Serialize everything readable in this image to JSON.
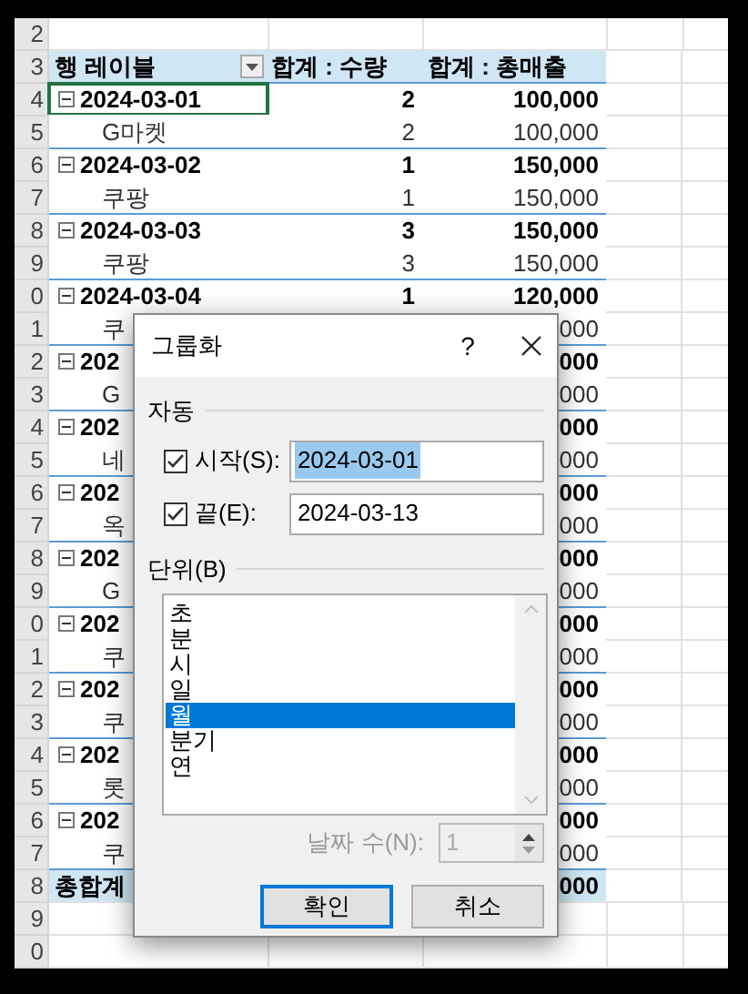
{
  "sheet": {
    "row_numbers": [
      "2",
      "3",
      "4",
      "5",
      "6",
      "7",
      "8",
      "9",
      "0",
      "1",
      "2",
      "3",
      "4",
      "5",
      "6",
      "7",
      "8",
      "9",
      "0",
      "1",
      "2",
      "3",
      "4",
      "5",
      "6",
      "7",
      "8",
      "9",
      "0"
    ],
    "header": {
      "row_label": "행 레이블",
      "sum_qty": "합계 : 수량",
      "sum_sales": "합계 : 총매출"
    },
    "rows": [
      {
        "kind": "date",
        "label": "2024-03-01",
        "qty": "2",
        "sales": "100,000",
        "expanded": true,
        "selected": true
      },
      {
        "kind": "item",
        "label": "G마켓",
        "qty": "2",
        "sales": "100,000",
        "selected": false
      },
      {
        "kind": "date",
        "label": "2024-03-02",
        "qty": "1",
        "sales": "150,000",
        "expanded": true,
        "selected": false
      },
      {
        "kind": "item",
        "label": "쿠팡",
        "qty": "1",
        "sales": "150,000",
        "selected": false
      },
      {
        "kind": "date",
        "label": "2024-03-03",
        "qty": "3",
        "sales": "150,000",
        "expanded": true,
        "selected": false
      },
      {
        "kind": "item",
        "label": "쿠팡",
        "qty": "3",
        "sales": "150,000",
        "selected": false
      },
      {
        "kind": "date",
        "label": "2024-03-04",
        "qty": "1",
        "sales": "120,000",
        "expanded": true,
        "selected": false
      },
      {
        "kind": "item",
        "label": "쿠",
        "sales": "000",
        "selected": false
      },
      {
        "kind": "date",
        "label": "202",
        "sales": "000",
        "expanded": true,
        "selected": false
      },
      {
        "kind": "item",
        "label": "G",
        "sales": "000",
        "selected": false
      },
      {
        "kind": "date",
        "label": "202",
        "sales": "000",
        "expanded": true,
        "selected": false
      },
      {
        "kind": "item",
        "label": "네",
        "sales": "000",
        "selected": false
      },
      {
        "kind": "date",
        "label": "202",
        "sales": "000",
        "expanded": true,
        "selected": false
      },
      {
        "kind": "item",
        "label": "옥",
        "sales": "000",
        "selected": false
      },
      {
        "kind": "date",
        "label": "202",
        "sales": "000",
        "expanded": true,
        "selected": false
      },
      {
        "kind": "item",
        "label": "G",
        "sales": "000",
        "selected": false
      },
      {
        "kind": "date",
        "label": "202",
        "sales": "000",
        "expanded": true,
        "selected": false
      },
      {
        "kind": "item",
        "label": "쿠",
        "sales": "000",
        "selected": false
      },
      {
        "kind": "date",
        "label": "202",
        "sales": "000",
        "expanded": true,
        "selected": false
      },
      {
        "kind": "item",
        "label": "쿠",
        "sales": "000",
        "selected": false
      },
      {
        "kind": "date",
        "label": "202",
        "sales": "000",
        "expanded": true,
        "selected": false
      },
      {
        "kind": "item",
        "label": "롯",
        "sales": "000",
        "selected": false
      },
      {
        "kind": "date",
        "label": "202",
        "sales": "000",
        "expanded": true,
        "selected": false
      },
      {
        "kind": "item",
        "label": "쿠",
        "sales": "000",
        "selected": false
      },
      {
        "kind": "total",
        "label": "총합계",
        "sales": "000",
        "selected": false
      }
    ]
  },
  "dialog": {
    "title": "그룹화",
    "help": "?",
    "auto_section": "자동",
    "start": {
      "label": "시작(S):",
      "checked": true,
      "value": "2024-03-01"
    },
    "end": {
      "label": "끝(E):",
      "checked": true,
      "value": "2024-03-13"
    },
    "unit_section": "단위(B)",
    "units": [
      {
        "label": "초",
        "selected": false
      },
      {
        "label": "분",
        "selected": false
      },
      {
        "label": "시",
        "selected": false
      },
      {
        "label": "일",
        "selected": false
      },
      {
        "label": "월",
        "selected": true
      },
      {
        "label": "분기",
        "selected": false
      },
      {
        "label": "연",
        "selected": false
      }
    ],
    "days": {
      "label": "날짜 수(N):",
      "value": "1",
      "disabled": true
    },
    "buttons": [
      {
        "label": "확인",
        "default": true
      },
      {
        "label": "취소",
        "default": false
      }
    ]
  }
}
